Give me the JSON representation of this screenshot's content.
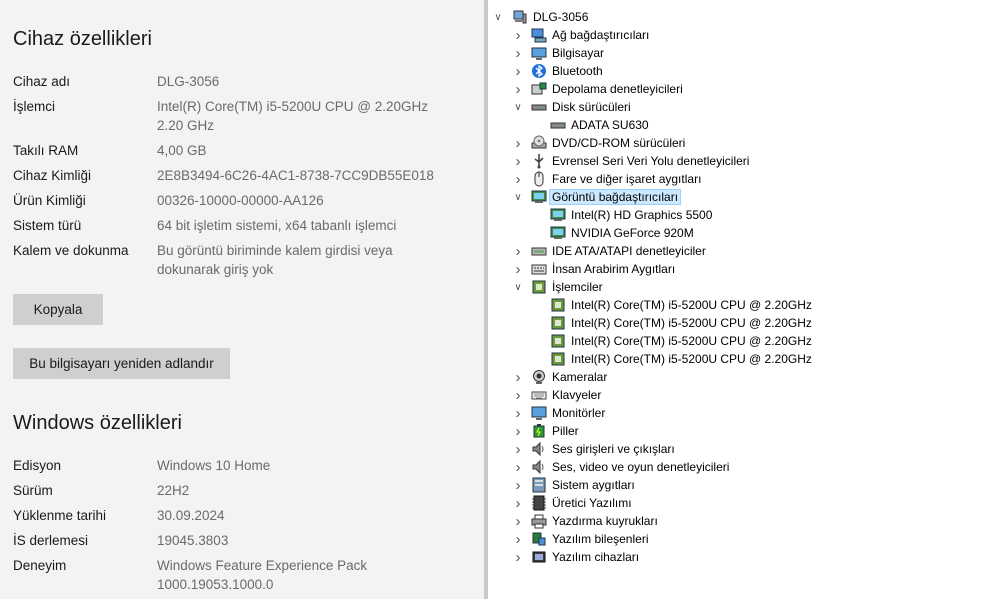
{
  "device_specs": {
    "title": "Cihaz özellikleri",
    "rows": [
      {
        "key": "Cihaz adı",
        "value": "DLG-3056"
      },
      {
        "key": "İşlemci",
        "value": "Intel(R) Core(TM) i5-5200U CPU @ 2.20GHz",
        "value2": "2.20 GHz"
      },
      {
        "key": "Takılı RAM",
        "value": "4,00 GB"
      },
      {
        "key": "Cihaz Kimliği",
        "value": "2E8B3494-6C26-4AC1-8738-7CC9DB55E018"
      },
      {
        "key": "Ürün Kimliği",
        "value": "00326-10000-00000-AA126"
      },
      {
        "key": "Sistem türü",
        "value": "64 bit işletim sistemi, x64 tabanlı işlemci"
      },
      {
        "key": "Kalem ve dokunma",
        "value": "Bu görüntü biriminde kalem girdisi veya",
        "value2": "dokunarak giriş yok"
      }
    ],
    "copy_button": "Kopyala",
    "rename_button": "Bu bilgisayarı yeniden adlandır"
  },
  "windows_specs": {
    "title": "Windows özellikleri",
    "rows": [
      {
        "key": "Edisyon",
        "value": "Windows 10 Home"
      },
      {
        "key": "Sürüm",
        "value": "22H2"
      },
      {
        "key": "Yüklenme tarihi",
        "value": "30.09.2024"
      },
      {
        "key": "İS derlemesi",
        "value": "19045.3803"
      },
      {
        "key": "Deneyim",
        "value": "Windows Feature Experience Pack",
        "value2": "1000.19053.1000.0"
      }
    ]
  },
  "device_tree": {
    "root": "DLG-3056",
    "nodes": [
      {
        "label": "Ağ bağdaştırıcıları",
        "icon": "network-icon",
        "level": 1,
        "state": "collapsed"
      },
      {
        "label": "Bilgisayar",
        "icon": "computer-icon",
        "level": 1,
        "state": "collapsed"
      },
      {
        "label": "Bluetooth",
        "icon": "bluetooth-icon",
        "level": 1,
        "state": "collapsed"
      },
      {
        "label": "Depolama denetleyicileri",
        "icon": "storage-controller-icon",
        "level": 1,
        "state": "collapsed"
      },
      {
        "label": "Disk sürücüleri",
        "icon": "disk-drive-icon",
        "level": 1,
        "state": "expanded"
      },
      {
        "label": "ADATA SU630",
        "icon": "disk-drive-icon",
        "level": 2,
        "state": "leaf"
      },
      {
        "label": "DVD/CD-ROM sürücüleri",
        "icon": "dvd-icon",
        "level": 1,
        "state": "collapsed"
      },
      {
        "label": "Evrensel Seri Veri Yolu denetleyicileri",
        "icon": "usb-icon",
        "level": 1,
        "state": "collapsed"
      },
      {
        "label": "Fare ve diğer işaret aygıtları",
        "icon": "mouse-icon",
        "level": 1,
        "state": "collapsed"
      },
      {
        "label": "Görüntü bağdaştırıcıları",
        "icon": "display-adapter-icon",
        "level": 1,
        "state": "expanded",
        "selected": true
      },
      {
        "label": "Intel(R) HD Graphics 5500",
        "icon": "display-adapter-icon",
        "level": 2,
        "state": "leaf"
      },
      {
        "label": "NVIDIA GeForce 920M",
        "icon": "display-adapter-icon",
        "level": 2,
        "state": "leaf"
      },
      {
        "label": "IDE ATA/ATAPI denetleyiciler",
        "icon": "ide-icon",
        "level": 1,
        "state": "collapsed"
      },
      {
        "label": "İnsan Arabirim Aygıtları",
        "icon": "hid-icon",
        "level": 1,
        "state": "collapsed"
      },
      {
        "label": "İşlemciler",
        "icon": "processor-icon",
        "level": 1,
        "state": "expanded"
      },
      {
        "label": "Intel(R) Core(TM) i5-5200U CPU @ 2.20GHz",
        "icon": "processor-icon",
        "level": 2,
        "state": "leaf"
      },
      {
        "label": "Intel(R) Core(TM) i5-5200U CPU @ 2.20GHz",
        "icon": "processor-icon",
        "level": 2,
        "state": "leaf"
      },
      {
        "label": "Intel(R) Core(TM) i5-5200U CPU @ 2.20GHz",
        "icon": "processor-icon",
        "level": 2,
        "state": "leaf"
      },
      {
        "label": "Intel(R) Core(TM) i5-5200U CPU @ 2.20GHz",
        "icon": "processor-icon",
        "level": 2,
        "state": "leaf"
      },
      {
        "label": "Kameralar",
        "icon": "camera-icon",
        "level": 1,
        "state": "collapsed"
      },
      {
        "label": "Klavyeler",
        "icon": "keyboard-icon",
        "level": 1,
        "state": "collapsed"
      },
      {
        "label": "Monitörler",
        "icon": "monitor-icon",
        "level": 1,
        "state": "collapsed"
      },
      {
        "label": "Piller",
        "icon": "battery-icon",
        "level": 1,
        "state": "collapsed"
      },
      {
        "label": "Ses girişleri ve çıkışları",
        "icon": "speaker-icon",
        "level": 1,
        "state": "collapsed"
      },
      {
        "label": "Ses, video ve oyun denetleyicileri",
        "icon": "speaker-icon",
        "level": 1,
        "state": "collapsed"
      },
      {
        "label": "Sistem aygıtları",
        "icon": "system-device-icon",
        "level": 1,
        "state": "collapsed"
      },
      {
        "label": "Üretici Yazılımı",
        "icon": "firmware-icon",
        "level": 1,
        "state": "collapsed"
      },
      {
        "label": "Yazdırma kuyrukları",
        "icon": "printer-icon",
        "level": 1,
        "state": "collapsed"
      },
      {
        "label": "Yazılım bileşenleri",
        "icon": "software-component-icon",
        "level": 1,
        "state": "collapsed"
      },
      {
        "label": "Yazılım cihazları",
        "icon": "software-device-icon",
        "level": 1,
        "state": "collapsed"
      }
    ]
  },
  "colors": {
    "left_background": "#f3f3f3",
    "button_background": "#cfcfcf",
    "selection_background": "#cce8ff",
    "value_text": "#6a6a6a"
  }
}
